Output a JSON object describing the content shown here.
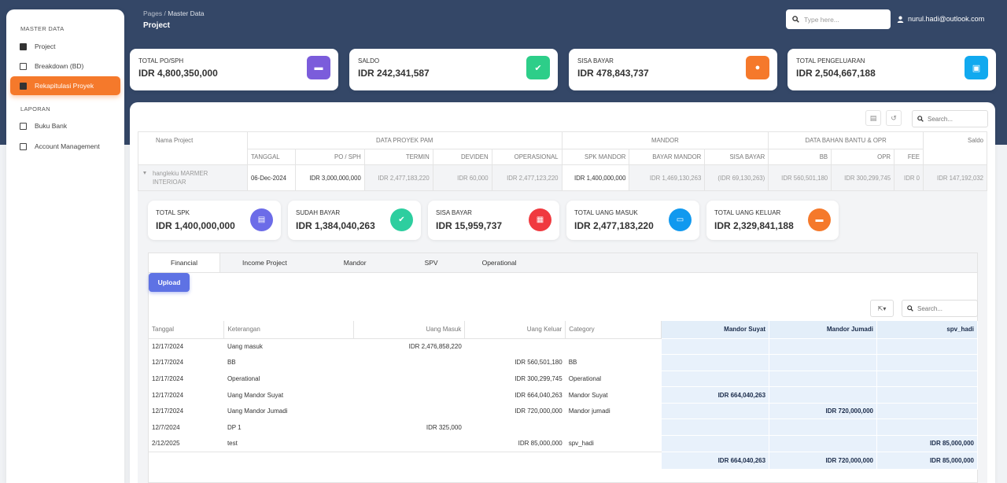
{
  "sidebar": {
    "section1": "MASTER DATA",
    "section2": "LAPORAN",
    "items": [
      {
        "label": "Project"
      },
      {
        "label": "Breakdown (BD)"
      },
      {
        "label": "Rekapitulasi Proyek"
      },
      {
        "label": "Buku Bank"
      },
      {
        "label": "Account Management"
      }
    ]
  },
  "header": {
    "crumb_parent": "Pages",
    "crumb_sep": "/",
    "crumb_current": "Master Data",
    "title": "Project",
    "search_placeholder": "Type here...",
    "user": "nurul.hadi@outlook.com"
  },
  "stats": [
    {
      "label": "TOTAL PO/SPH",
      "value": "IDR 4,800,350,000",
      "color": "#7b5cdb"
    },
    {
      "label": "SALDO",
      "value": "IDR 242,341,587",
      "color": "#2dce89"
    },
    {
      "label": "SISA BAYAR",
      "value": "IDR 478,843,737",
      "color": "#f5792b"
    },
    {
      "label": "TOTAL PENGELUARAN",
      "value": "IDR 2,504,667,188",
      "color": "#11a9ef"
    }
  ],
  "table_search_placeholder": "Search...",
  "project_table": {
    "groups": [
      "Nama Project",
      "DATA PROYEK PAM",
      "MANDOR",
      "DATA BAHAN BANTU & OPR",
      "Saldo"
    ],
    "subheaders": [
      "TANGGAL",
      "PO / SPH",
      "TERMIN",
      "DEVIDEN",
      "OPERASIONAL",
      "SPK MANDOR",
      "BAYAR MANDOR",
      "SISA BAYAR",
      "BB",
      "OPR",
      "FEE"
    ],
    "row": {
      "expand": "▾",
      "name": "hanglekiu MARMER INTERIOAR",
      "tanggal": "06-Dec-2024",
      "po": "IDR 3,000,000,000",
      "termin": "IDR 2,477,183,220",
      "deviden": "IDR 60,000",
      "operasional": "IDR 2,477,123,220",
      "spk_mandor": "IDR 1,400,000,000",
      "bayar_mandor": "IDR 1,469,130,263",
      "sisa_bayar": "(IDR 69,130,263)",
      "bb": "IDR 560,501,180",
      "opr": "IDR 300,299,745",
      "fee": "IDR 0",
      "saldo": "IDR 147,192,032"
    }
  },
  "mini_stats": [
    {
      "label": "TOTAL SPK",
      "value": "IDR 1,400,000,000",
      "color": "#6c6ce8"
    },
    {
      "label": "SUDAH BAYAR",
      "value": "IDR 1,384,040,263",
      "color": "#2dce9f"
    },
    {
      "label": "SISA BAYAR",
      "value": "IDR 15,959,737",
      "color": "#f0393f"
    },
    {
      "label": "TOTAL UANG MASUK",
      "value": "IDR 2,477,183,220",
      "color": "#1199ef"
    },
    {
      "label": "TOTAL UANG KELUAR",
      "value": "IDR 2,329,841,188",
      "color": "#f5792b"
    }
  ],
  "tabs": [
    "Financial",
    "Income Project",
    "Mandor",
    "SPV",
    "Operational"
  ],
  "upload_label": "Upload",
  "export_label": "▾",
  "financial": {
    "columns": [
      "Tanggal",
      "Keterangan",
      "Uang Masuk",
      "Uang Keluar",
      "Category",
      "Mandor Suyat",
      "Mandor Jumadi",
      "spv_hadi"
    ],
    "rows": [
      [
        "12/17/2024",
        "Uang masuk",
        "IDR 2,476,858,220",
        "",
        "",
        "",
        "",
        ""
      ],
      [
        "12/17/2024",
        "BB",
        "",
        "IDR 560,501,180",
        "BB",
        "",
        "",
        ""
      ],
      [
        "12/17/2024",
        "Operational",
        "",
        "IDR 300,299,745",
        "Operational",
        "",
        "",
        ""
      ],
      [
        "12/17/2024",
        "Uang Mandor Suyat",
        "",
        "IDR 664,040,263",
        "Mandor Suyat",
        "IDR 664,040,263",
        "",
        ""
      ],
      [
        "12/17/2024",
        "Uang Mandor Jumadi",
        "",
        "IDR 720,000,000",
        "Mandor jumadi",
        "",
        "IDR 720,000,000",
        ""
      ],
      [
        "12/7/2024",
        "DP 1",
        "IDR 325,000",
        "",
        "",
        "",
        "",
        ""
      ],
      [
        "2/12/2025",
        "test",
        "",
        "IDR 85,000,000",
        "spv_hadi",
        "",
        "",
        "IDR 85,000,000"
      ]
    ],
    "totals": [
      "IDR 664,040,263",
      "IDR 720,000,000",
      "IDR 85,000,000"
    ]
  }
}
